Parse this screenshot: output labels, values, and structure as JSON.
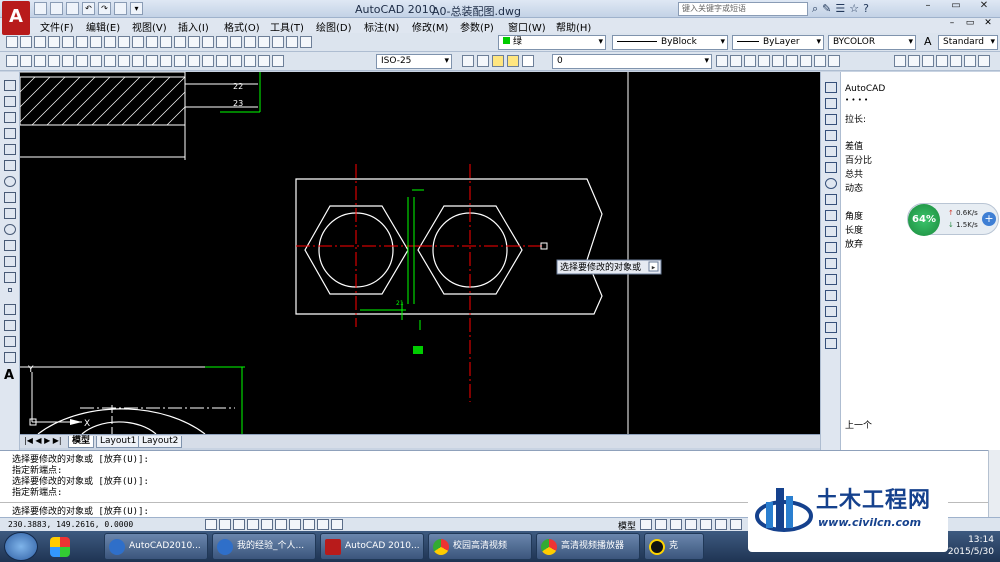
{
  "titlebar": {
    "app_logo": "A",
    "app_title": "AutoCAD 2010",
    "document_title": "A0-总装配图.dwg",
    "search_placeholder": "键入关键字或短语",
    "window_controls": [
      "–",
      "▭",
      "✕"
    ]
  },
  "menubar": {
    "items": [
      "文件(F)",
      "编辑(E)",
      "视图(V)",
      "插入(I)",
      "格式(O)",
      "工具(T)",
      "绘图(D)",
      "标注(N)",
      "修改(M)",
      "参数(P)",
      "窗口(W)",
      "帮助(H)"
    ],
    "doc_controls": [
      "–",
      "▭",
      "✕"
    ]
  },
  "toolbar_top": {
    "layer_value": "绿",
    "linetype_value": "ByBlock",
    "lineweight_value": "ByLayer",
    "color_value": "BYCOLOR",
    "text_style_value": "Standard"
  },
  "toolbar_second": {
    "dim_style_value": "ISO-25",
    "layer_state_value": "0"
  },
  "drawing": {
    "dimension_labels": [
      "22",
      "23"
    ],
    "cursor_tooltip": "选择要修改的对象或",
    "small_labels": [
      "21"
    ]
  },
  "layout_tabs": {
    "nav": "|◀ ◀ ▶ ▶|",
    "tabs": [
      "模型",
      "Layout1",
      "Layout2"
    ],
    "active": "模型"
  },
  "properties_panel": {
    "title": "AutoCAD",
    "dots": "• • • •",
    "heading": "拉长:",
    "options_a": [
      "差值",
      "百分比",
      "总共",
      "动态"
    ],
    "options_b": [
      "角度",
      "长度",
      "放弃"
    ],
    "footer": "上一个"
  },
  "net_monitor": {
    "percent": "64%",
    "percent_value": 64,
    "upload": "0.6K/s",
    "download": "1.5K/s",
    "plus": "+"
  },
  "command_lines": [
    "选择要修改的对象或 [放弃(U)]:",
    "指定新端点:",
    "选择要修改的对象或 [放弃(U)]:",
    "指定新端点:",
    "选择要修改的对象或 [放弃(U)]:"
  ],
  "statusbar": {
    "coordinates": "230.3883, 149.2616, 0.0000",
    "model_label": "模型"
  },
  "taskbar": {
    "buttons": [
      {
        "label": "AutoCAD2010...",
        "icon": "ie-icon",
        "color": "#2f6fc9"
      },
      {
        "label": "我的经验_个人...",
        "icon": "ie-icon",
        "color": "#2f6fc9"
      },
      {
        "label": "AutoCAD 2010...",
        "icon": "autocad-icon",
        "color": "#b81b1b"
      },
      {
        "label": "校园高清视频",
        "icon": "chrome-icon",
        "color": "#e8a52a"
      },
      {
        "label": "高清视频播放器",
        "icon": "chrome-icon",
        "color": "#e8a52a"
      },
      {
        "label": "克",
        "icon": "qq-icon",
        "color": "#1a1a1a"
      }
    ],
    "time": "13:14",
    "date": "2015/5/30"
  },
  "watermark": {
    "title": "土木工程网",
    "url": "www.civilcn.com"
  },
  "colors": {
    "viewport_bg": "#000000",
    "cad_white": "#ffffff",
    "cad_red": "#ff0000",
    "cad_green": "#00ff00"
  }
}
